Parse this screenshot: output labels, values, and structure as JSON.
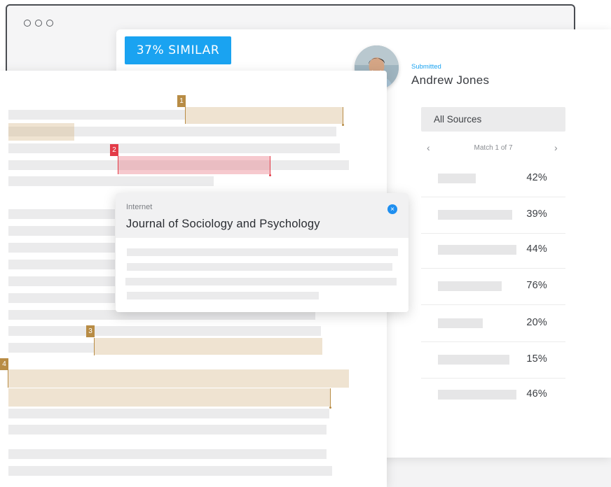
{
  "similarity_badge": "37% SIMILAR",
  "submission": {
    "label": "Submitted",
    "name": "Andrew Jones"
  },
  "sources_panel": {
    "tab_label": "All Sources",
    "match_counter": "Match 1 of 7",
    "prev_icon": "chevron-left-icon",
    "next_icon": "chevron-right-icon",
    "prev_glyph": "‹",
    "next_glyph": "›",
    "sources": [
      {
        "percent": "42%"
      },
      {
        "percent": "39%"
      },
      {
        "percent": "44%"
      },
      {
        "percent": "76%"
      },
      {
        "percent": "20%"
      },
      {
        "percent": "15%"
      },
      {
        "percent": "46%"
      }
    ]
  },
  "match_markers": [
    "1",
    "2",
    "3",
    "4"
  ],
  "popover": {
    "category": "Internet",
    "title": "Journal of Sociology and Psychology",
    "close_icon": "close-icon",
    "close_glyph": "×"
  },
  "colors": {
    "accent": "#1aa3f1",
    "match_tan": "#b88c45",
    "match_red": "#e33b48"
  }
}
